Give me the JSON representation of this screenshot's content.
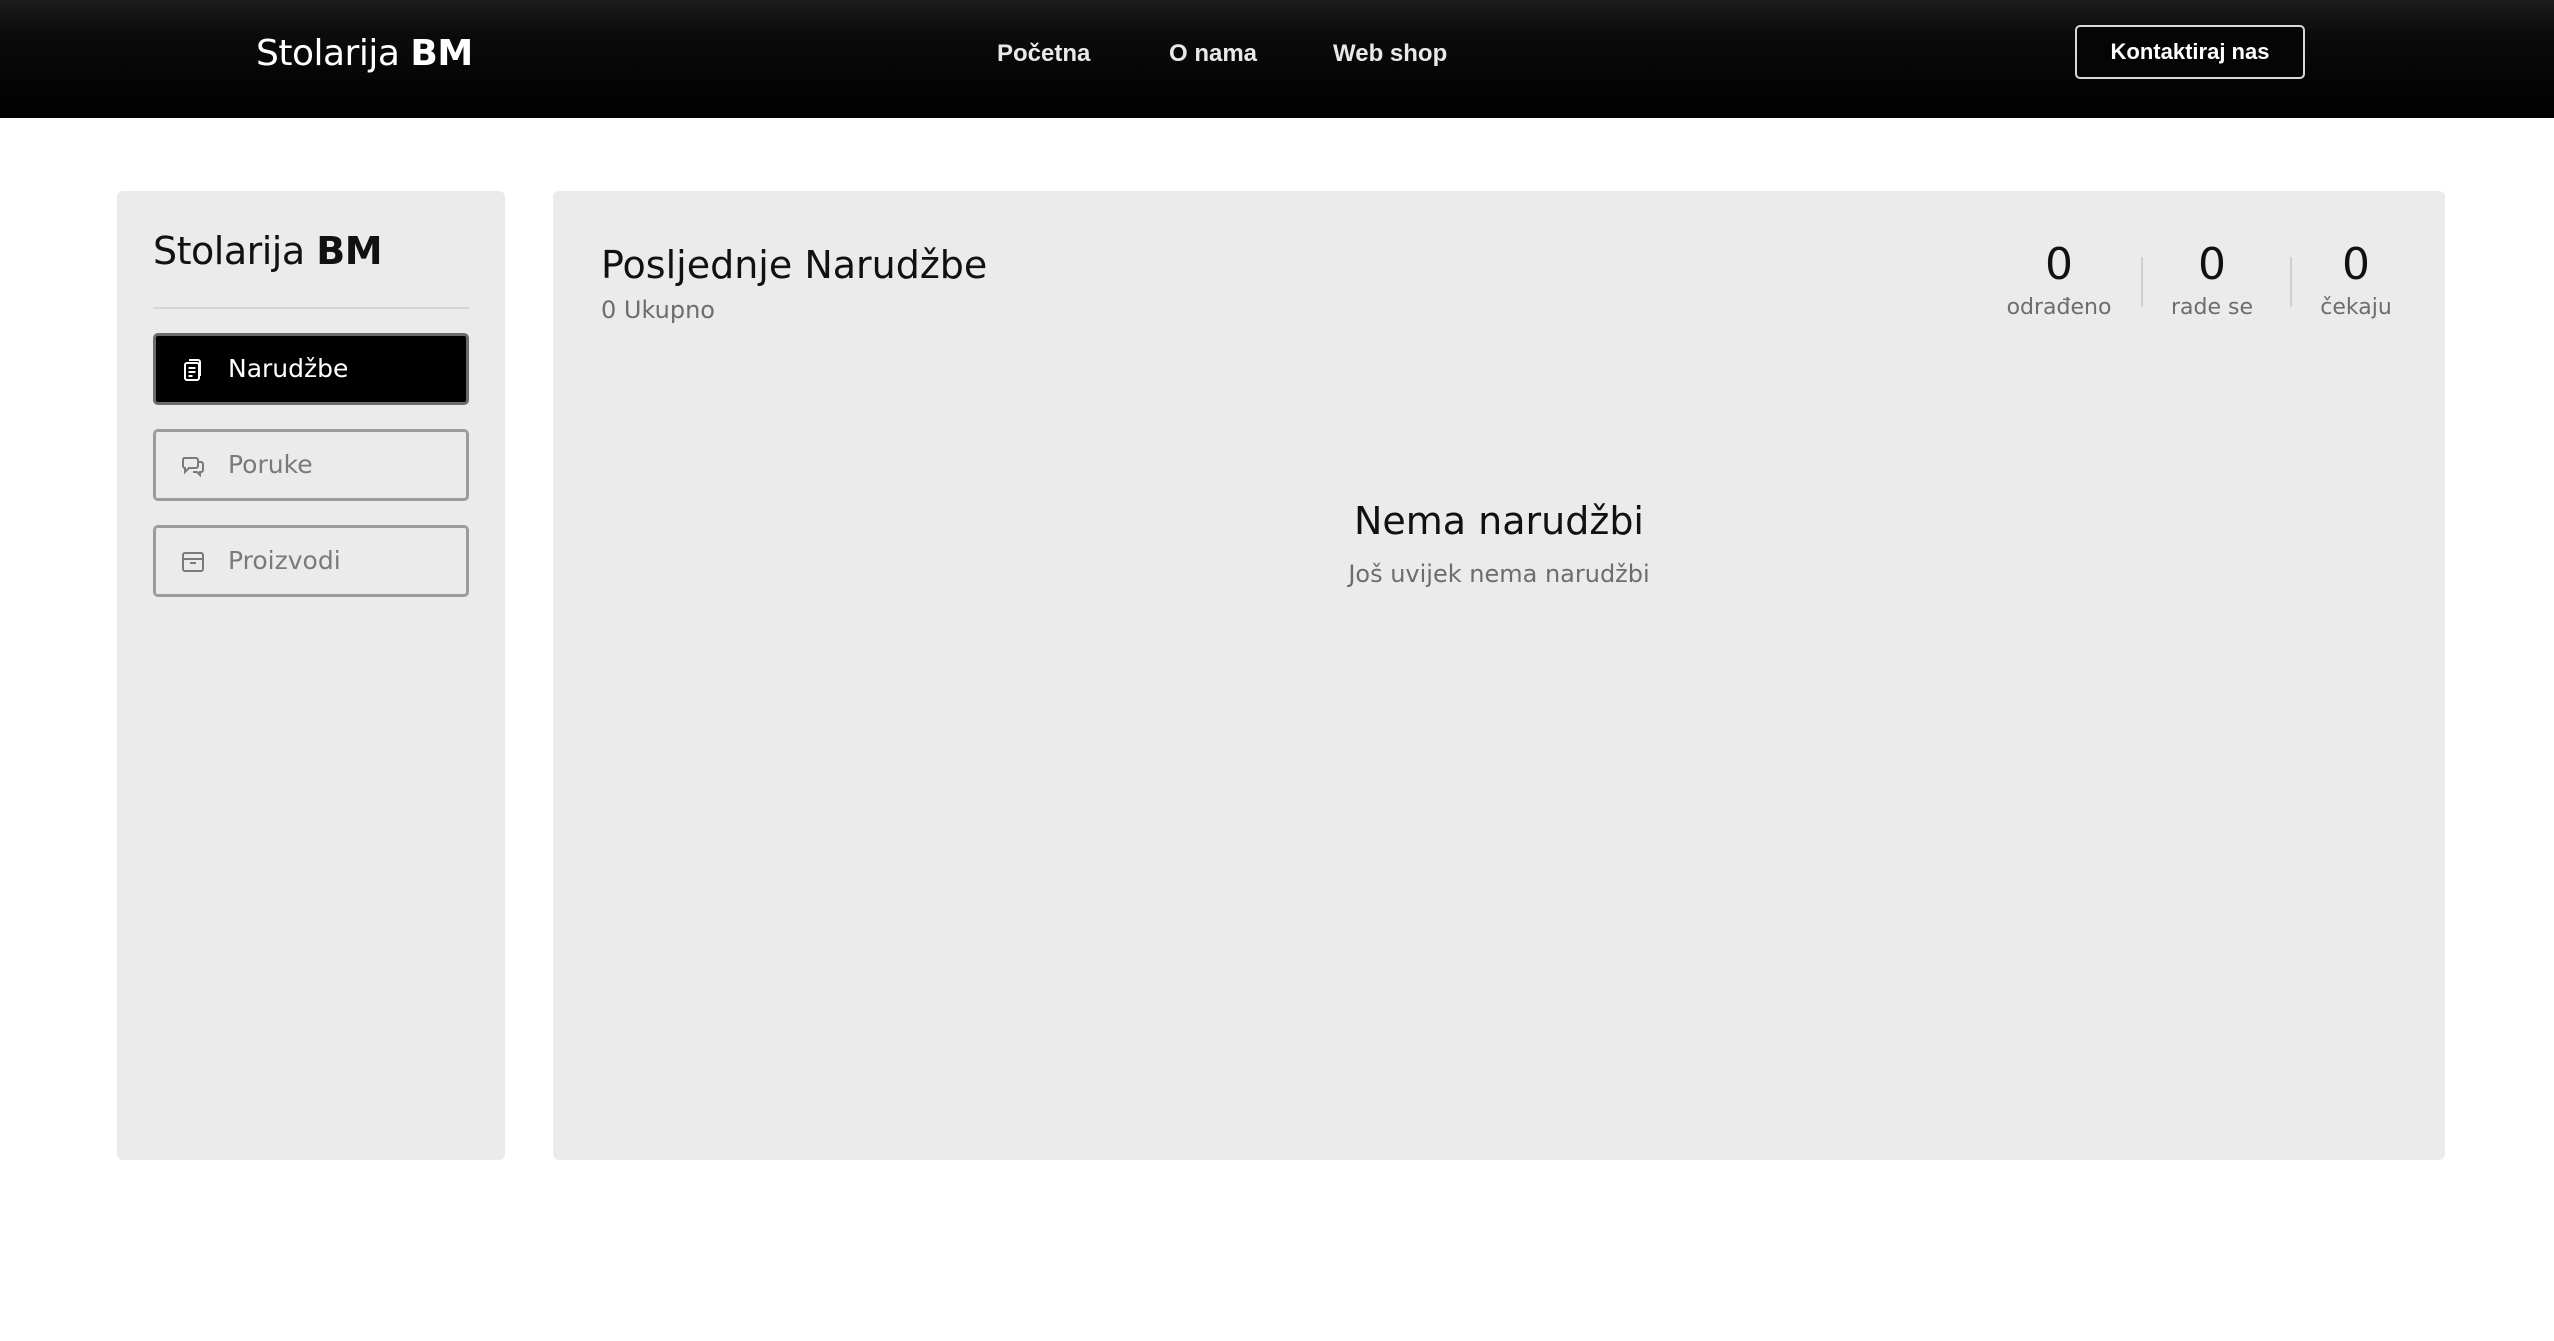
{
  "header": {
    "brand_light": "Stolarija",
    "brand_bold": "BM",
    "nav": [
      {
        "label": "Početna"
      },
      {
        "label": "O nama"
      },
      {
        "label": "Web shop"
      }
    ],
    "cta_label": "Kontaktiraj nas"
  },
  "sidebar": {
    "brand_light": "Stolarija",
    "brand_bold": "BM",
    "items": [
      {
        "label": "Narudžbe",
        "icon": "clipboard-icon",
        "active": true
      },
      {
        "label": "Poruke",
        "icon": "chat-icon",
        "active": false
      },
      {
        "label": "Proizvodi",
        "icon": "box-icon",
        "active": false
      }
    ]
  },
  "main": {
    "title": "Posljednje Narudžbe",
    "subtitle": "0 Ukupno",
    "stats": [
      {
        "value": "0",
        "label": "odrađeno"
      },
      {
        "value": "0",
        "label": "rade se"
      },
      {
        "value": "0",
        "label": "čekaju"
      }
    ],
    "empty_title": "Nema narudžbi",
    "empty_subtitle": "Još uvijek nema narudžbi"
  },
  "colors": {
    "header_bg": "#000000",
    "panel_bg": "#ebebeb",
    "active_item_bg": "#000000",
    "muted_text": "#6d6d6d"
  }
}
